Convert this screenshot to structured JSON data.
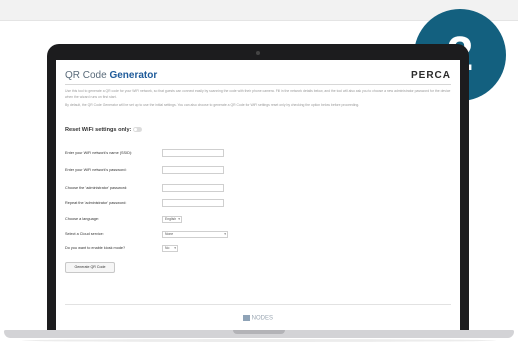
{
  "app": {
    "title_plain": "QR Code ",
    "title_accent": "Generator",
    "brand": "PERCA"
  },
  "intro": {
    "paragraph1": "Use this tool to generate a QR code for your WiFi network, so that guests can connect easily by scanning the code with their phone camera. Fill in the network details below, and the tool will also ask you to choose a new administrator password for the device when the wizard runs on first start.",
    "paragraph2": "By default, the QR Code Generator will be set up to use the initial settings. You can also choose to generate a QR Code for WiFi settings reset only by checking the option below before proceeding."
  },
  "reset": {
    "label": "Reset WiFi settings only:",
    "enabled": false
  },
  "form": {
    "ssid_label": "Enter your WiFi network's name (SSID):",
    "wifi_password_label": "Enter your WiFi network's password:",
    "admin_password_label": "Choose the 'administrator' password:",
    "admin_password_repeat_label": "Repeat the 'administrator' password:",
    "language_label": "Choose a language:",
    "language_value": "English",
    "cloud_label": "Select a Cloud service:",
    "cloud_value": "None",
    "kiosk_label": "Do you want to enable kiosk mode?",
    "kiosk_value": "No"
  },
  "actions": {
    "generate_label": "Generate QR Code"
  },
  "footer": {
    "brand": "NODES"
  },
  "badge": {
    "step": "2"
  },
  "colors": {
    "badge": "#13607f",
    "title_accent": "#1f5b9a"
  }
}
